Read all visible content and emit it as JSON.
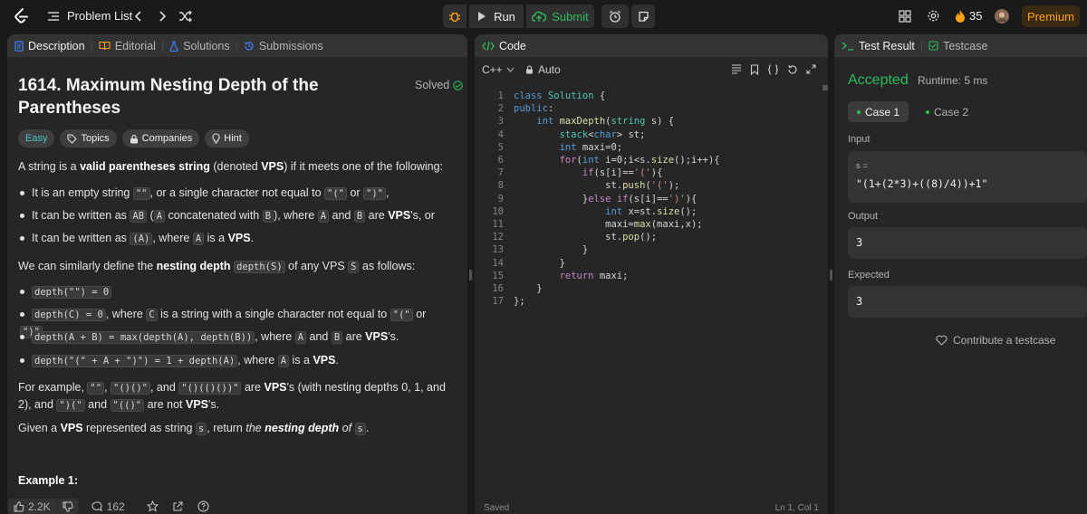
{
  "topbar": {
    "problem_list": "Problem List",
    "run": "Run",
    "submit": "Submit",
    "streak": "35",
    "premium": "Premium"
  },
  "left_tabs": [
    "Description",
    "Editorial",
    "Solutions",
    "Submissions"
  ],
  "problem": {
    "title": "1614. Maximum Nesting Depth of the Parentheses",
    "solved": "Solved",
    "tags": [
      "Easy",
      "Topics",
      "Companies",
      "Hint"
    ]
  },
  "description": {
    "p1_pre": "A string is a ",
    "p1_bold": "valid parentheses string",
    "p1_mid": " (denoted ",
    "p1_vps": "VPS",
    "p1_post": ") if it meets one of the following:",
    "li1_pre": "It is an empty string ",
    "li1_code1": "\"\"",
    "li1_mid": ", or a single character not equal to ",
    "li1_code2": "\"(\"",
    "li1_or": " or ",
    "li1_code3": "\")\"",
    "li1_post": ",",
    "li2_pre": "It can be written as ",
    "li2_code1": "AB",
    "li2_a": " (",
    "li2_code2": "A",
    "li2_b": " concatenated with ",
    "li2_code3": "B",
    "li2_c": "), where ",
    "li2_code4": "A",
    "li2_and": " and ",
    "li2_code5": "B",
    "li2_are": " are ",
    "li2_vps": "VPS",
    "li2_post": "'s, or",
    "li3_pre": "It can be written as ",
    "li3_code1": "(A)",
    "li3_mid": ", where ",
    "li3_code2": "A",
    "li3_is": " is a ",
    "li3_vps": "VPS",
    "li3_post": ".",
    "p2_pre": "We can similarly define the ",
    "p2_bold": "nesting depth",
    "p2_code1": "depth(S)",
    "p2_mid": " of any VPS ",
    "p2_code2": "S",
    "p2_post": " as follows:",
    "d1_code": "depth(\"\") = 0",
    "d2_code1": "depth(C) = 0",
    "d2_mid": ", where ",
    "d2_code2": "C",
    "d2_post": " is a string with a single character not equal to ",
    "d2_code3": "\"(\"",
    "d2_or": " or ",
    "d2_code4": "\")\"",
    "d2_end": ".",
    "d3_code": "depth(A + B) = max(depth(A), depth(B))",
    "d3_mid": ", where ",
    "d3_code2": "A",
    "d3_and": " and ",
    "d3_code3": "B",
    "d3_are": " are ",
    "d3_vps": "VPS",
    "d3_post": "'s.",
    "d4_code": "depth(\"(\" + A + \")\") = 1 + depth(A)",
    "d4_mid": ", where ",
    "d4_code2": "A",
    "d4_is": " is a ",
    "d4_vps": "VPS",
    "d4_post": ".",
    "ex_pre": "For example, ",
    "ex_c1": "\"\"",
    "ex_comma1": ", ",
    "ex_c2": "\"()()\"",
    "ex_and": ", and ",
    "ex_c3": "\"()(()())\"",
    "ex_are": " are ",
    "ex_vps": "VPS",
    "ex_mid": "'s (with nesting depths 0, 1, and 2), and ",
    "ex_c4": "\")(\"",
    "ex_and2": " and ",
    "ex_c5": "\"(()\"",
    "ex_arenot": " are not ",
    "ex_vps2": "VPS",
    "ex_end": "'s.",
    "g_pre": "Given a ",
    "g_vps": "VPS",
    "g_mid": " represented as string ",
    "g_code": "s",
    "g_ret": ", return ",
    "g_the": "the ",
    "g_nd": "nesting depth",
    "g_of": " of ",
    "g_code2": "s",
    "g_end": ".",
    "example1": "Example 1:"
  },
  "bottom": {
    "likes": "2.2K",
    "comments": "162"
  },
  "code_panel": {
    "title": "Code",
    "lang": "C++",
    "auto": "Auto",
    "status_left": "Saved",
    "status_right": "Ln 1, Col 1"
  },
  "code_lines": [
    "class Solution {",
    "public:",
    "    int maxDepth(string s) {",
    "        stack<char> st;",
    "        int maxi=0;",
    "        for(int i=0;i<s.size();i++){",
    "            if(s[i]=='('){",
    "                st.push('(');",
    "            }else if(s[i]==')'){",
    "                int x=st.size();",
    "                maxi=max(maxi,x);",
    "                st.pop();",
    "            }",
    "        }",
    "        return maxi;",
    "    }",
    "};"
  ],
  "result": {
    "tab1": "Test Result",
    "tab2": "Testcase",
    "status": "Accepted",
    "runtime": "Runtime: 5 ms",
    "case1": "Case 1",
    "case2": "Case 2",
    "input_label": "Input",
    "input_var": "s =",
    "input_value": "\"(1+(2*3)+((8)/4))+1\"",
    "output_label": "Output",
    "output_value": "3",
    "expected_label": "Expected",
    "expected_value": "3",
    "contribute": "Contribute a testcase"
  },
  "colors": {
    "accent_green": "#2cbb5d",
    "easy": "#46c6c2",
    "orange": "#ffa116"
  }
}
